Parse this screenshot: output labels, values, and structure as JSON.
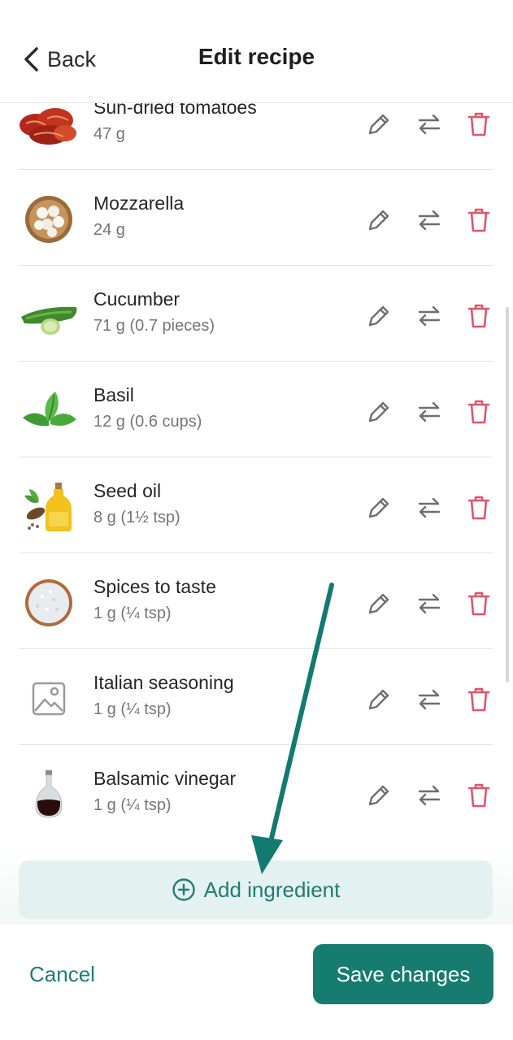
{
  "header": {
    "back_label": "Back",
    "title": "Edit recipe"
  },
  "ingredients": [
    {
      "name": "Sun-dried tomatoes",
      "qty": "47 g",
      "icon": "sun-dried-tomatoes-image"
    },
    {
      "name": "Mozzarella",
      "qty": "24 g",
      "icon": "mozzarella-image"
    },
    {
      "name": "Cucumber",
      "qty": "71 g (0.7 pieces)",
      "icon": "cucumber-image"
    },
    {
      "name": "Basil",
      "qty": "12 g (0.6 cups)",
      "icon": "basil-image"
    },
    {
      "name": "Seed oil",
      "qty": "8 g (1½ tsp)",
      "icon": "seed-oil-image"
    },
    {
      "name": "Spices to taste",
      "qty": "1 g (¼ tsp)",
      "icon": "spices-image"
    },
    {
      "name": "Italian seasoning",
      "qty": "1 g (¼ tsp)",
      "icon": "image-placeholder-icon"
    },
    {
      "name": "Balsamic vinegar",
      "qty": "1 g (¼ tsp)",
      "icon": "balsamic-vinegar-image"
    }
  ],
  "add_button": {
    "label": "Add ingredient"
  },
  "footer": {
    "cancel_label": "Cancel",
    "save_label": "Save changes"
  },
  "colors": {
    "accent": "#177c70",
    "accent_text": "#1f7d72",
    "delete": "#e0566a",
    "action_icon": "#6e6e6e",
    "add_bg": "#e4f1f1",
    "annotation_arrow": "#137a71"
  }
}
